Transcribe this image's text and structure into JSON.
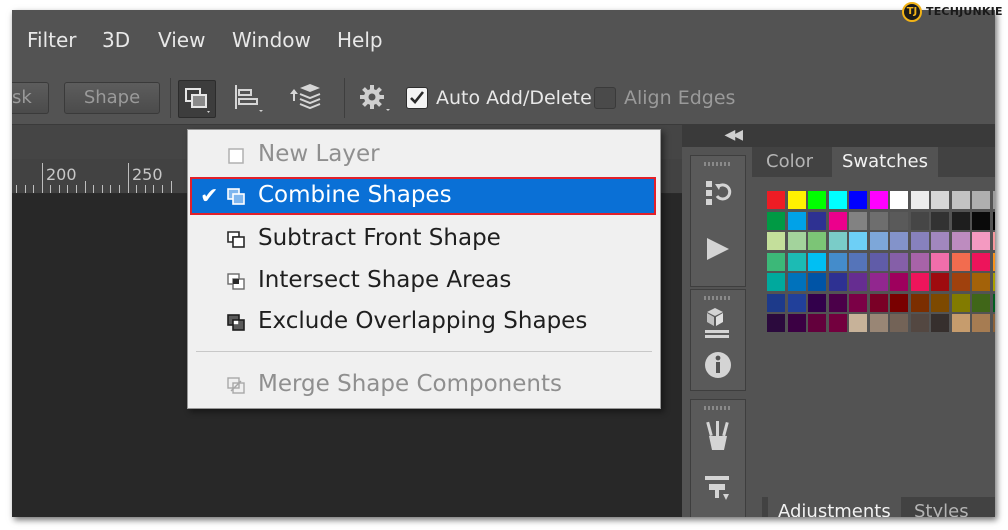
{
  "menu": {
    "items": [
      "Filter",
      "3D",
      "View",
      "Window",
      "Help"
    ]
  },
  "options_bar": {
    "mask_fragment": "sk",
    "shape_button": "Shape",
    "auto_add_delete": {
      "label": "Auto Add/Delete",
      "checked": true
    },
    "align_edges": {
      "label": "Align Edges",
      "checked": false
    }
  },
  "ruler": {
    "labels": [
      "200",
      "250"
    ]
  },
  "dropdown": {
    "items": [
      {
        "label": "New Layer",
        "enabled": false,
        "selected": false,
        "icon": "new-layer-icon"
      },
      {
        "label": "Combine Shapes",
        "enabled": true,
        "selected": true,
        "icon": "combine-shapes-icon"
      },
      {
        "label": "Subtract Front Shape",
        "enabled": true,
        "selected": false,
        "icon": "subtract-front-shape-icon"
      },
      {
        "label": "Intersect Shape Areas",
        "enabled": true,
        "selected": false,
        "icon": "intersect-shape-areas-icon"
      },
      {
        "label": "Exclude Overlapping Shapes",
        "enabled": true,
        "selected": false,
        "icon": "exclude-overlapping-shapes-icon"
      },
      {
        "label": "Merge Shape Components",
        "enabled": false,
        "selected": false,
        "icon": "merge-shape-components-icon"
      }
    ],
    "highlight_color": "#0a70d6",
    "highlight_border": "#e2202a"
  },
  "panel": {
    "tabs": [
      "Color",
      "Swatches"
    ],
    "active_tab": "Swatches",
    "bottom_tabs": [
      "Adjustments",
      "Styles"
    ]
  },
  "swatches": [
    [
      "#ed1c24",
      "#fff200",
      "#00ff00",
      "#00ffff",
      "#0000ff",
      "#ff00ff",
      "#ffffff",
      "#ebebeb",
      "#d7d7d7",
      "#c3c3c3",
      "#afafaf",
      "#9b9b9b"
    ],
    [
      "#009a44",
      "#00a2e8",
      "#2e3192",
      "#ec008c",
      "#828282",
      "#6e6e6e",
      "#5a5a5a",
      "#464646",
      "#323232",
      "#1e1e1e",
      "#0a0a0a",
      "#000000"
    ],
    [
      "#c4df9b",
      "#a3d39c",
      "#7cc576",
      "#7accc8",
      "#6dcff6",
      "#7da7d9",
      "#8393ca",
      "#8781bd",
      "#a187be",
      "#bd8cbf",
      "#f49ac1",
      "#f5989d"
    ],
    [
      "#3cb878",
      "#1cbbb4",
      "#00bff3",
      "#448ccb",
      "#5574b9",
      "#605ca8",
      "#855fa8",
      "#a763a8",
      "#f06eaa",
      "#f26c4f",
      "#ed145b",
      "#f7941d"
    ],
    [
      "#00a99d",
      "#0072bc",
      "#0054a6",
      "#2e3192",
      "#662d91",
      "#92278f",
      "#9e005d",
      "#ed145b",
      "#9e0b0f",
      "#a0410d",
      "#a36209",
      "#aba000"
    ],
    [
      "#1d3a8a",
      "#21409a",
      "#32004b",
      "#4b0049",
      "#7b0046",
      "#7a0026",
      "#790000",
      "#7b2e00",
      "#7d4900",
      "#827b00",
      "#406618",
      "#005e20"
    ],
    [
      "#2b0a3d",
      "#3b0043",
      "#63003c",
      "#73003e",
      "#c7b299",
      "#998675",
      "#736357",
      "#534741",
      "#362f2d",
      "#c69c6d",
      "#a67c52",
      "#8c6239"
    ]
  ],
  "logo": {
    "initial": "TJ",
    "text": "TECHJUNKIE"
  }
}
